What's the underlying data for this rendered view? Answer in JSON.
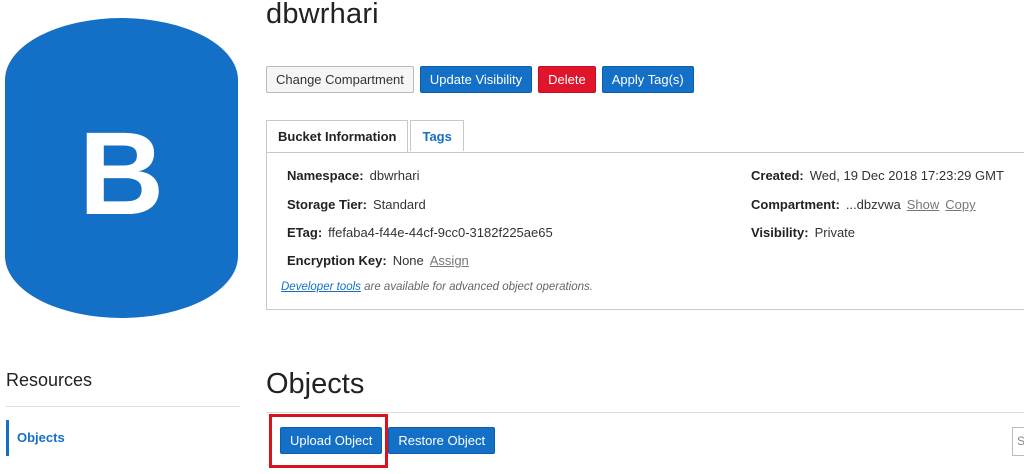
{
  "bucket": {
    "logo_letter": "B",
    "name": "dbwrhari",
    "accent_color": "#1470c6"
  },
  "actions": {
    "change_compartment": "Change Compartment",
    "update_visibility": "Update Visibility",
    "delete": "Delete",
    "apply_tags": "Apply Tag(s)"
  },
  "tabs": {
    "bucket_info": "Bucket Information",
    "tags": "Tags"
  },
  "info": {
    "namespace_label": "Namespace:",
    "namespace_value": "dbwrhari",
    "storage_tier_label": "Storage Tier:",
    "storage_tier_value": "Standard",
    "etag_label": "ETag:",
    "etag_value": "ffefaba4-f44e-44cf-9cc0-3182f225ae65",
    "encryption_key_label": "Encryption Key:",
    "encryption_key_value": "None",
    "encryption_key_link": "Assign",
    "created_label": "Created:",
    "created_value": "Wed, 19 Dec 2018 17:23:29 GMT",
    "compartment_label": "Compartment:",
    "compartment_value": "...dbzvwa",
    "compartment_show": "Show",
    "compartment_copy": "Copy",
    "visibility_label": "Visibility:",
    "visibility_value": "Private",
    "dev_tools_link": "Developer tools",
    "dev_tools_text": " are available for advanced object operations."
  },
  "resources": {
    "title": "Resources",
    "items": [
      {
        "label": "Objects"
      }
    ]
  },
  "objects": {
    "title": "Objects",
    "upload_button": "Upload Object",
    "restore_button": "Restore Object",
    "search_placeholder": "S"
  }
}
